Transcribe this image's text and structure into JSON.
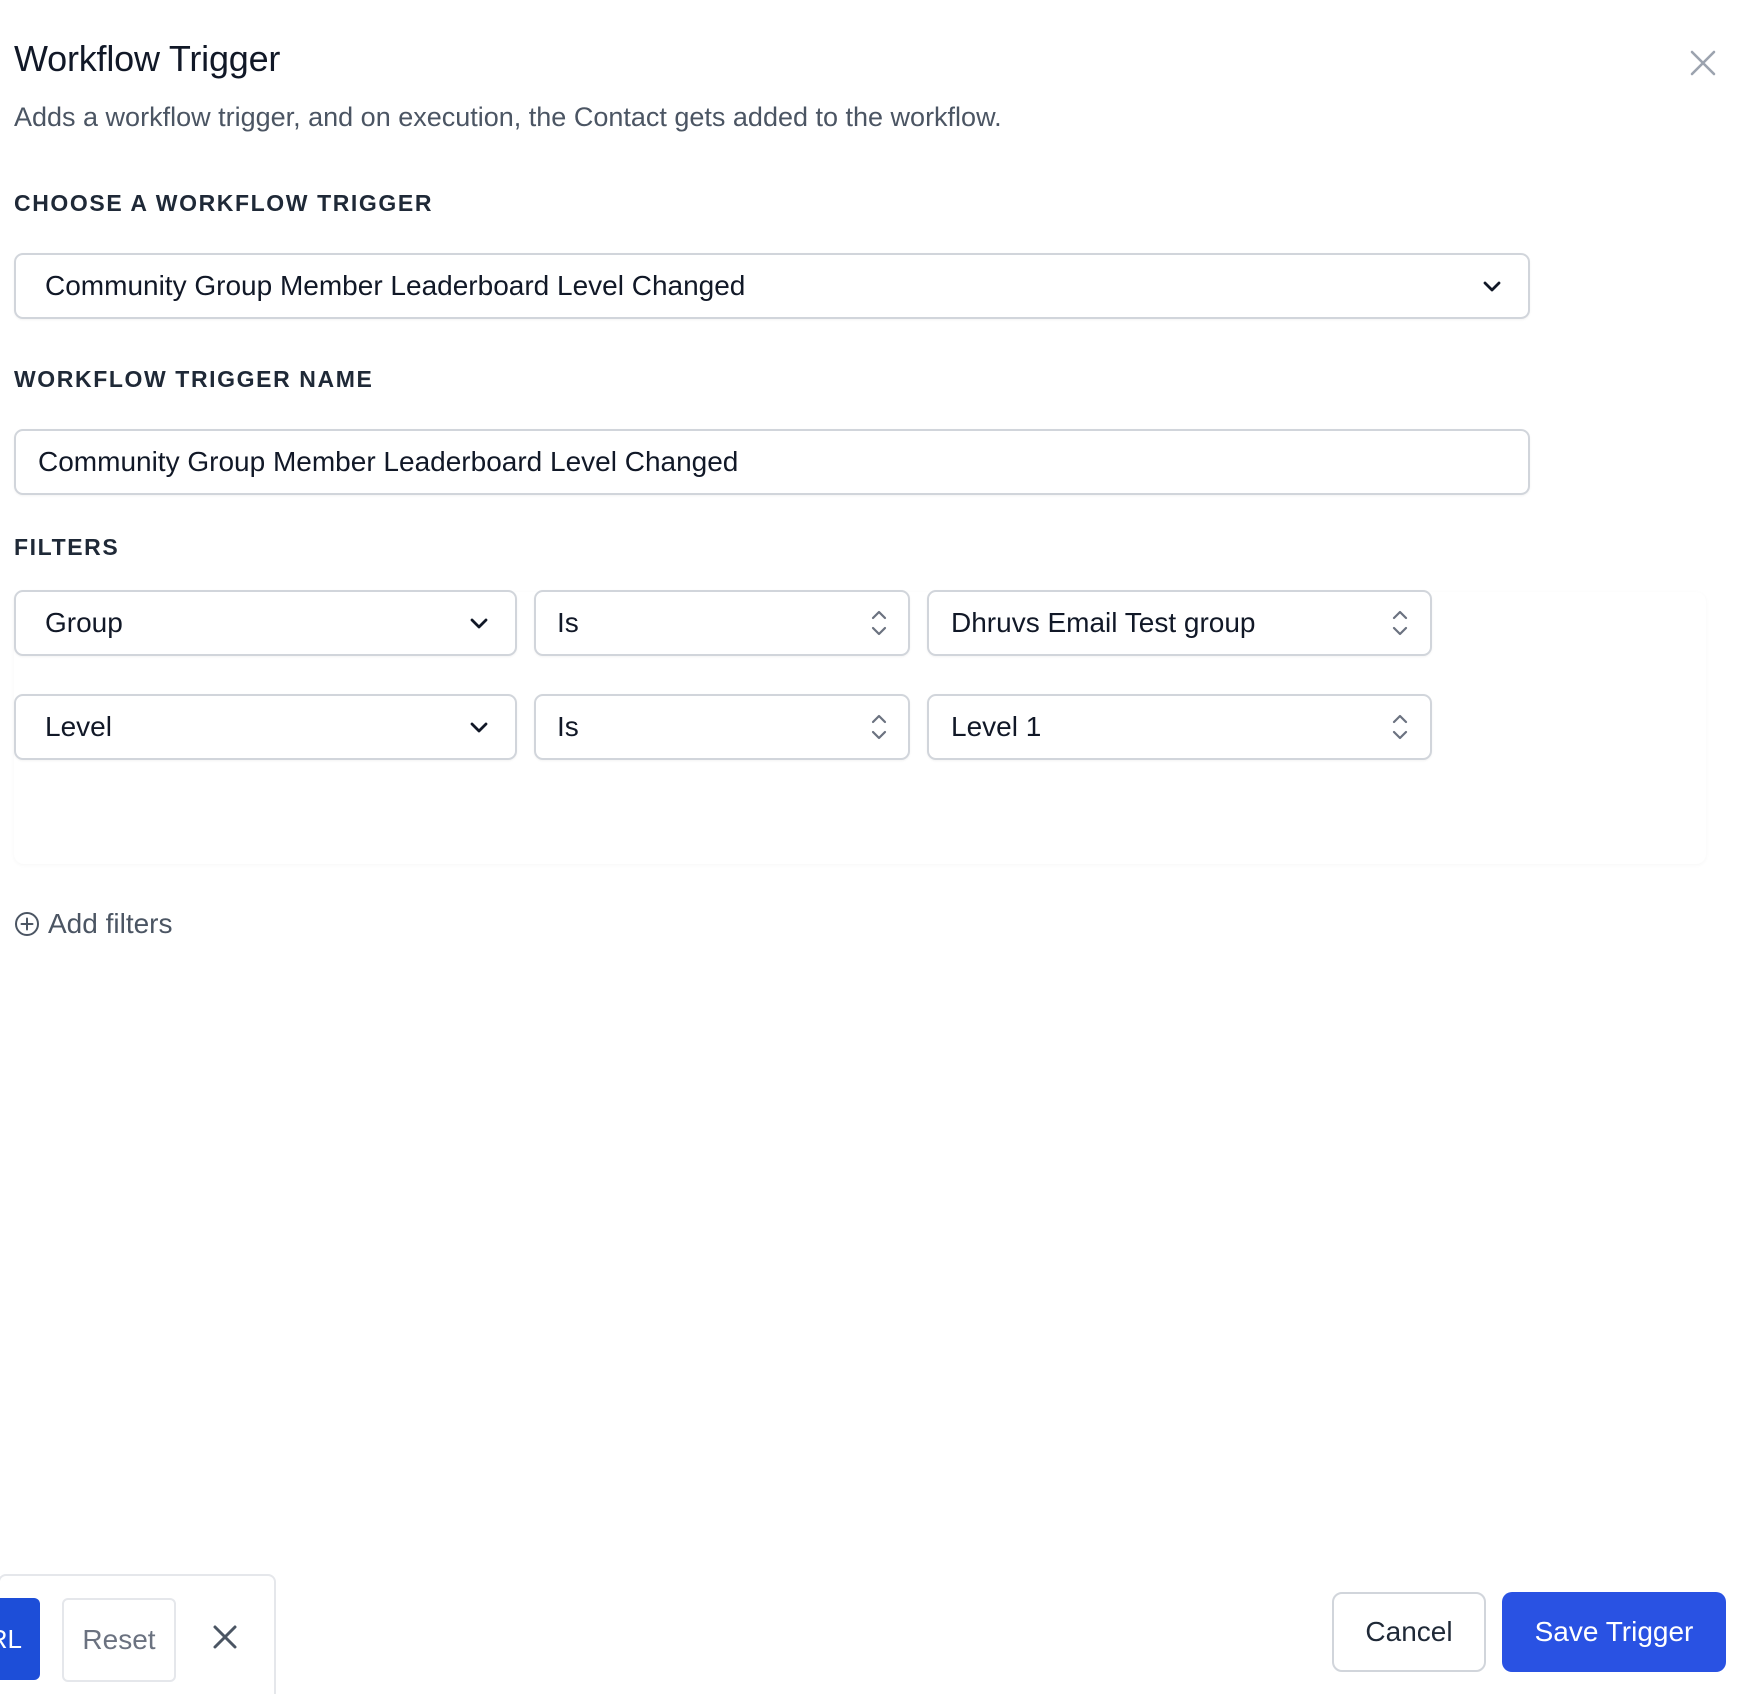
{
  "header": {
    "title": "Workflow Trigger",
    "subtitle": "Adds a workflow trigger, and on execution, the Contact gets added to the workflow.",
    "close_icon": "close-icon"
  },
  "trigger_select": {
    "label": "CHOOSE A WORKFLOW TRIGGER",
    "value": "Community Group Member Leaderboard Level Changed",
    "icon": "chevron-down-icon"
  },
  "trigger_name": {
    "label": "WORKFLOW TRIGGER NAME",
    "value": "Community Group Member Leaderboard Level Changed"
  },
  "filters": {
    "label": "FILTERS",
    "rows": [
      {
        "field": "Group",
        "operator": "Is",
        "value": "Dhruvs Email Test group"
      },
      {
        "field": "Level",
        "operator": "Is",
        "value": "Level 1"
      }
    ],
    "add_label": "Add filters",
    "add_icon": "plus-circle-icon"
  },
  "bottom_toolbar": {
    "url_button_label": "RL",
    "reset_label": "Reset",
    "close_icon": "close-icon"
  },
  "footer": {
    "cancel_label": "Cancel",
    "save_label": "Save Trigger"
  },
  "colors": {
    "primary": "#2952e3",
    "border": "#d1d5db",
    "text": "#111827",
    "muted": "#4b5563"
  }
}
